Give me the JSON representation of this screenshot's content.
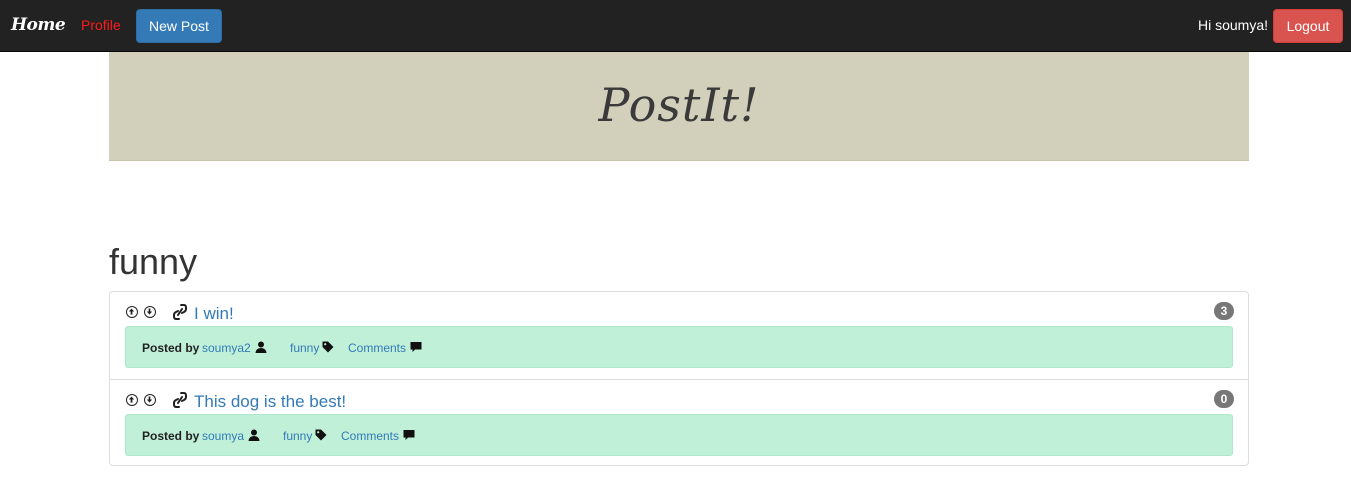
{
  "navbar": {
    "brand": "Home",
    "profile_label": "Profile",
    "new_post_label": "New Post",
    "greeting": "Hi soumya!",
    "logout_label": "Logout"
  },
  "banner": {
    "title": "PostIt!"
  },
  "page": {
    "tag_heading": "funny"
  },
  "posts": [
    {
      "title": "I win!",
      "comment_count": "3",
      "posted_by_label": "Posted by",
      "author": "soumya2",
      "tag": "funny",
      "comments_label": "Comments"
    },
    {
      "title": "This dog is the best!",
      "comment_count": "0",
      "posted_by_label": "Posted by",
      "author": "soumya",
      "tag": "funny",
      "comments_label": "Comments"
    }
  ],
  "icons": {
    "upvote": "arrow-up-circle",
    "downvote": "arrow-down-circle",
    "link": "link-icon",
    "user": "user-icon",
    "tag": "tag-icon",
    "comment": "comment-icon"
  },
  "colors": {
    "navbar_bg": "#222222",
    "profile_link": "#ff1a1a",
    "primary_button": "#337ab7",
    "danger_button": "#d9534f",
    "banner_bg": "#d2d0bb",
    "meta_bg": "#c1f0d9",
    "badge_bg": "#777777"
  }
}
